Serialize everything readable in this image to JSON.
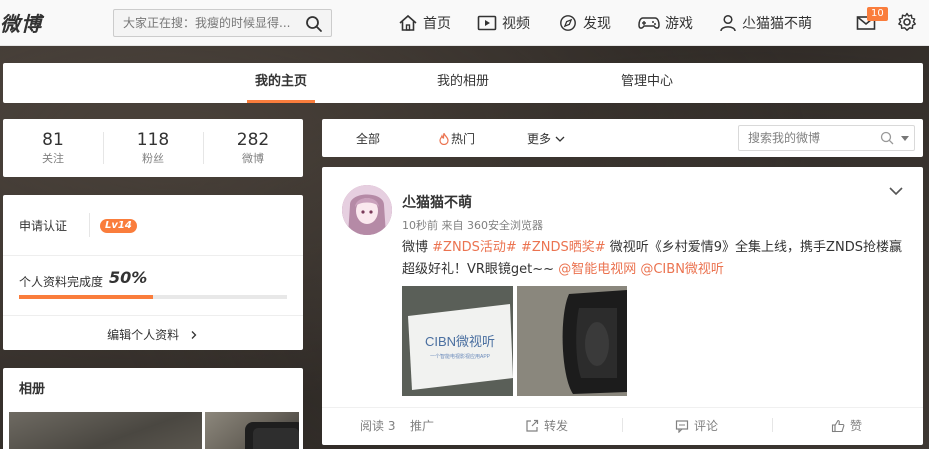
{
  "header": {
    "logo": "微博",
    "search_placeholder": "大家正在搜：我瘦的时候显得...",
    "nav": [
      {
        "label": "首页",
        "icon": "home-icon"
      },
      {
        "label": "视频",
        "icon": "video-icon"
      },
      {
        "label": "发现",
        "icon": "compass-icon"
      },
      {
        "label": "游戏",
        "icon": "gamepad-icon"
      },
      {
        "label": "尐猫猫不萌",
        "icon": "user-icon"
      }
    ],
    "mail_badge": "10"
  },
  "profile_tabs": [
    {
      "label": "我的主页",
      "active": true
    },
    {
      "label": "我的相册",
      "active": false
    },
    {
      "label": "管理中心",
      "active": false
    }
  ],
  "stats": [
    {
      "value": "81",
      "label": "关注"
    },
    {
      "value": "118",
      "label": "粉丝"
    },
    {
      "value": "282",
      "label": "微博"
    }
  ],
  "info": {
    "verify_label": "申请认证",
    "level": "Lv14",
    "completeness_label": "个人资料完成度",
    "completeness_value": "50%",
    "completeness_fraction": 0.5,
    "edit_label": "编辑个人资料"
  },
  "album": {
    "title": "相册"
  },
  "feed_filter": {
    "tabs": [
      "全部",
      "热门",
      "更多"
    ],
    "search_placeholder": "搜索我的微博"
  },
  "post": {
    "author": "尐猫猫不萌",
    "meta": "10秒前 来自 360安全浏览器",
    "text_prefix": "微博 ",
    "tag1": "#ZNDS活动#",
    "tag2": "#ZNDS晒奖#",
    "text_body": " 微视听《乡村爱情9》全集上线，携手ZNDS抢楼赢超级好礼！VR眼镜get~~",
    "mention1": "@智能电视网",
    "mention2": "@CIBN微视听",
    "pic1_text": "CIBN微视听",
    "pic1_subtext": "一个智能电视影视应用APP",
    "actions": [
      {
        "label": "阅读 3"
      },
      {
        "label": "推广"
      },
      {
        "label": "转发"
      },
      {
        "label": "评论"
      },
      {
        "label": "赞"
      }
    ]
  },
  "colors": {
    "accent": "#fa7d3c",
    "link": "#eb7350"
  }
}
